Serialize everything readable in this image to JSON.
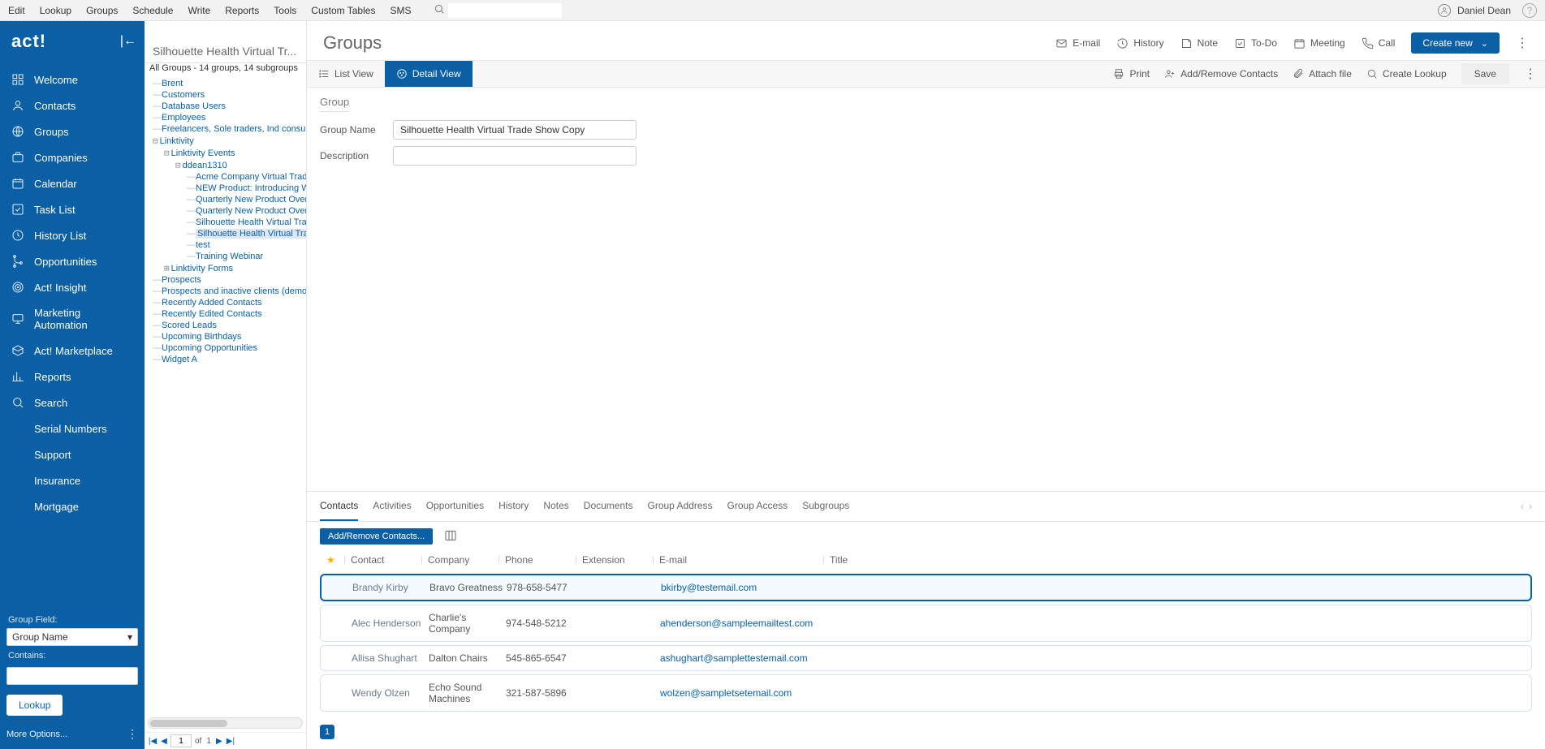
{
  "topmenu": [
    "Edit",
    "Lookup",
    "Groups",
    "Schedule",
    "Write",
    "Reports",
    "Tools",
    "Custom Tables",
    "SMS"
  ],
  "user": {
    "name": "Daniel Dean"
  },
  "search": {
    "placeholder": ""
  },
  "logo": "act!",
  "sidenav": [
    {
      "label": "Welcome",
      "icon": "grid"
    },
    {
      "label": "Contacts",
      "icon": "user"
    },
    {
      "label": "Groups",
      "icon": "globe"
    },
    {
      "label": "Companies",
      "icon": "briefcase"
    },
    {
      "label": "Calendar",
      "icon": "calendar"
    },
    {
      "label": "Task List",
      "icon": "check"
    },
    {
      "label": "History List",
      "icon": "clock"
    },
    {
      "label": "Opportunities",
      "icon": "branch"
    },
    {
      "label": "Act! Insight",
      "icon": "target"
    },
    {
      "label": "Marketing Automation",
      "icon": "monitor"
    },
    {
      "label": "Act! Marketplace",
      "icon": "box"
    },
    {
      "label": "Reports",
      "icon": "chart"
    },
    {
      "label": "Search",
      "icon": "search"
    },
    {
      "label": "Serial Numbers",
      "icon": ""
    },
    {
      "label": "Support",
      "icon": ""
    },
    {
      "label": "Insurance",
      "icon": ""
    },
    {
      "label": "Mortgage",
      "icon": ""
    }
  ],
  "group_field_label": "Group Field:",
  "group_field_value": "Group Name",
  "contains_label": "Contains:",
  "lookup_btn": "Lookup",
  "more_options": "More Options...",
  "tree_title": "Silhouette Health Virtual Tr...",
  "tree_sub": "All Groups - 14 groups, 14 subgroups",
  "tree": {
    "root": [
      "Brent",
      "Customers",
      "Database Users",
      "Employees",
      "Freelancers, Sole traders, Ind consultants (demo)"
    ],
    "linktivity": "Linktivity",
    "linktivity_events": "Linktivity Events",
    "ddean": "ddean1310",
    "events": [
      "Acme Company Virtual Trade Show",
      "NEW Product: Introducing Widget",
      "Quarterly New Product Overview",
      "Quarterly New Product Overview",
      "Silhouette Health Virtual Trade Show",
      "Silhouette Health Virtual Trade Show",
      "test",
      "Training Webinar"
    ],
    "selected_index": 5,
    "linktivity_forms": "Linktivity Forms",
    "bottom": [
      "Prospects",
      "Prospects and inactive clients (demo)",
      "Recently Added Contacts",
      "Recently Edited Contacts",
      "Scored Leads",
      "Upcoming Birthdays",
      "Upcoming Opportunities",
      "Widget A"
    ]
  },
  "pager": {
    "page": "1",
    "of_label": "of",
    "total": "1"
  },
  "page_title": "Groups",
  "header_actions": [
    "E-mail",
    "History",
    "Note",
    "To-Do",
    "Meeting",
    "Call"
  ],
  "create_new": "Create new",
  "view_tabs": {
    "list": "List View",
    "detail": "Detail View"
  },
  "toolbar_actions": {
    "print": "Print",
    "addremove": "Add/Remove Contacts",
    "attach": "Attach file",
    "lookup": "Create Lookup",
    "save": "Save"
  },
  "group_section": "Group",
  "form": {
    "name_label": "Group Name",
    "name_value": "Silhouette Health Virtual Trade Show Copy",
    "desc_label": "Description",
    "desc_value": ""
  },
  "content_tabs": [
    "Contacts",
    "Activities",
    "Opportunities",
    "History",
    "Notes",
    "Documents",
    "Group Address",
    "Group Access",
    "Subgroups"
  ],
  "active_content_tab": 0,
  "contacts_toolbar": {
    "addremove": "Add/Remove Contacts..."
  },
  "columns": [
    "Contact",
    "Company",
    "Phone",
    "Extension",
    "E-mail",
    "Title"
  ],
  "rows": [
    {
      "contact": "Brandy Kirby",
      "company": "Bravo Greatness",
      "phone": "978-658-5477",
      "ext": "",
      "email": "bkirby@testemail.com",
      "title": ""
    },
    {
      "contact": "Alec Henderson",
      "company": "Charlie's Company",
      "phone": "974-548-5212",
      "ext": "",
      "email": "ahenderson@sampleemailtest.com",
      "title": ""
    },
    {
      "contact": "Allisa Shughart",
      "company": "Dalton Chairs",
      "phone": "545-865-6547",
      "ext": "",
      "email": "ashughart@samplettestemail.com",
      "title": ""
    },
    {
      "contact": "Wendy Olzen",
      "company": "Echo Sound Machines",
      "phone": "321-587-5896",
      "ext": "",
      "email": "wolzen@sampletsetemail.com",
      "title": ""
    }
  ],
  "selected_row": 0,
  "page_num": "1"
}
